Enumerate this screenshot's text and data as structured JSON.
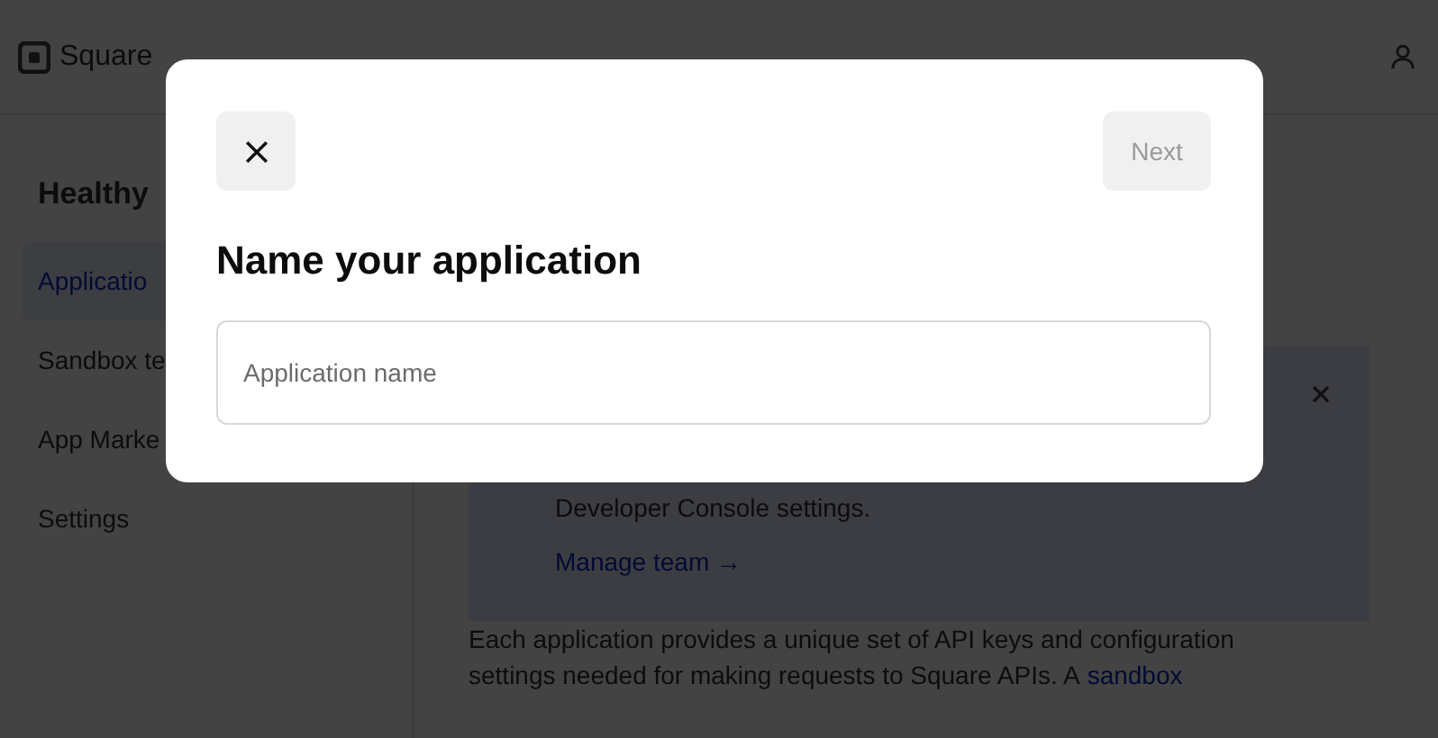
{
  "header": {
    "logo_text": "Square"
  },
  "sidebar": {
    "title": "Healthy",
    "items": [
      {
        "label": "Applicatio",
        "selected": true
      },
      {
        "label": "Sandbox te",
        "selected": false
      },
      {
        "label": "App Marke",
        "selected": false
      },
      {
        "label": "Settings",
        "selected": false
      }
    ]
  },
  "notice": {
    "text": "Developer Console settings.",
    "link": "Manage team →"
  },
  "intro": [
    {
      "text": "Each application provides a unique set of API keys and configuration"
    },
    {
      "text": "settings needed for making requests to Square APIs. A",
      "link": "sandbox"
    }
  ],
  "modal": {
    "title": "Name your application",
    "next": {
      "label": "Next",
      "disabled": true
    },
    "field": {
      "placeholder": "Application name"
    }
  }
}
